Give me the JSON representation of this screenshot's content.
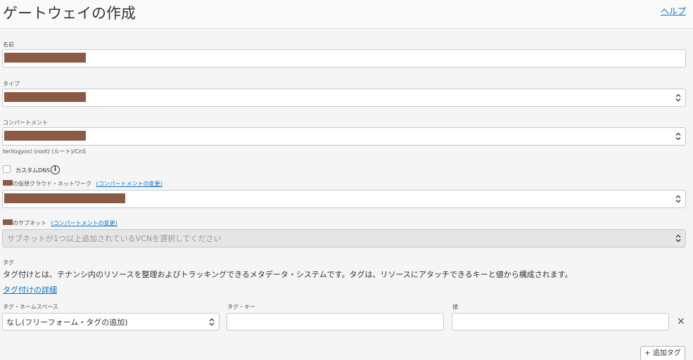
{
  "header": {
    "title": "ゲートウェイの作成",
    "help": "ヘルプ"
  },
  "name": {
    "label": "名前"
  },
  "type": {
    "label": "タイプ"
  },
  "compartment": {
    "label": "コンパートメント",
    "hint": "terilogyoci (root) (ルート)/CnS"
  },
  "custom_dns": {
    "label": "カスタムDNS",
    "info": "i",
    "checked": false
  },
  "vcn": {
    "label_suffix": "の仮想クラウド・ネットワーク",
    "change_link": "(コンパートメントの変更)"
  },
  "subnet": {
    "label_suffix": "のサブネット",
    "change_link": "(コンパートメントの変更)",
    "placeholder": "サブネットが1つ以上追加されているVCNを選択してください"
  },
  "tags": {
    "section_label": "タグ",
    "description": "タグ付けとは、テナンシ内のリソースを整理およびトラッキングできるメタデータ・システムです。タグは、リソースにアタッチできるキーと値から構成されます。",
    "details_link": "タグ付けの詳細",
    "namespace_label": "タグ・ネームスペース",
    "namespace_value": "なし(フリーフォーム・タグの追加)",
    "key_label": "タグ・キー",
    "value_label": "値",
    "remove_icon": "×",
    "add_button": "+ 追加タグ"
  },
  "icons": {
    "select": "chevron-up-down-icon",
    "remove": "close-icon",
    "info": "info-icon"
  },
  "colors": {
    "accent": "#0572ce",
    "redaction": "#8b5a44",
    "background": "#f5f5f5"
  }
}
